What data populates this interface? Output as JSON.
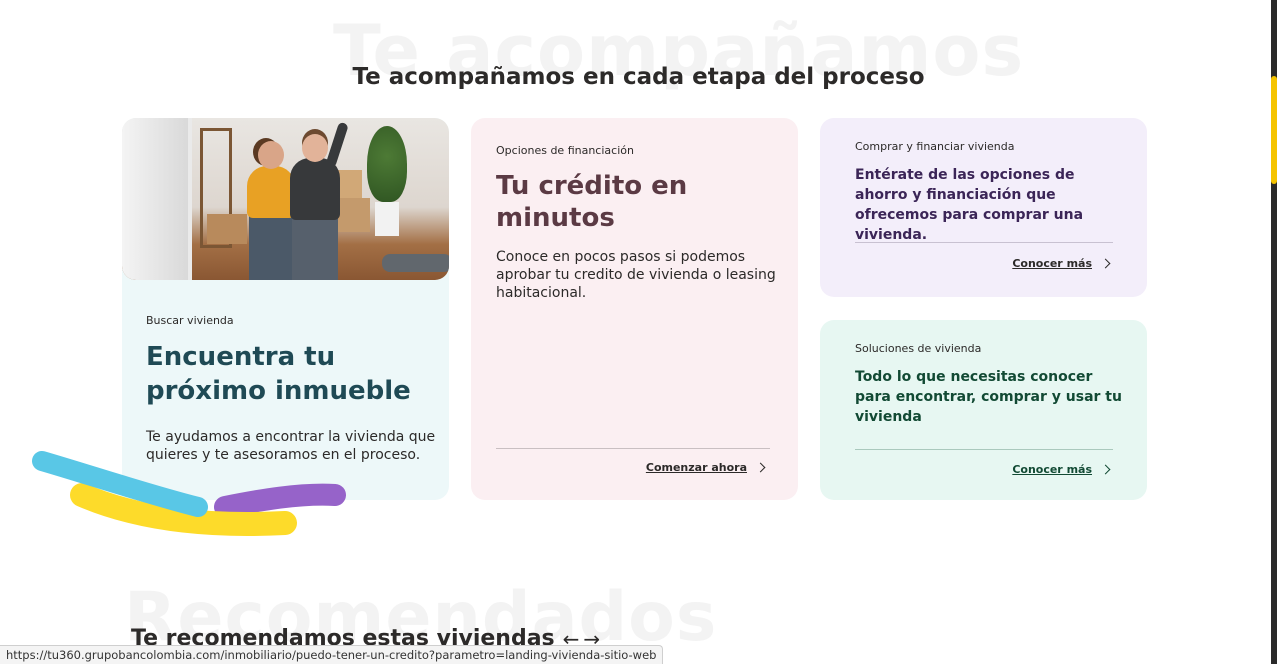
{
  "background_words": {
    "top": "Te acompañamos",
    "bottom": "Recomendados"
  },
  "section_title": "Te acompañamos en cada etapa del proceso",
  "cards": {
    "buscar": {
      "eyebrow": "Buscar vivienda",
      "headline": "Encuentra tu próximo inmueble",
      "body": "Te ayudamos a encontrar la vivienda que quieres y te asesoramos en el proceso."
    },
    "credito": {
      "eyebrow": "Opciones de financiación",
      "headline": "Tu crédito en minutos",
      "body": "Conoce en pocos pasos si podemos aprobar tu credito de vivienda o leasing habitacional.",
      "cta": "Comenzar ahora"
    },
    "comprar": {
      "eyebrow": "Comprar y financiar vivienda",
      "headline": "Entérate de las opciones de ahorro y financiación que ofrecemos para comprar una vivienda.",
      "cta": "Conocer más"
    },
    "soluciones": {
      "eyebrow": "Soluciones de vivienda",
      "headline": "Todo lo que necesitas conocer para encontrar, comprar y usar tu vivienda",
      "cta": "Conocer más"
    }
  },
  "recommended": {
    "title": "Te recomendamos estas viviendas",
    "prev_arrow": "←",
    "next_arrow": "→"
  },
  "status_bar_url": "https://tu360.grupobancolombia.com/inmobiliario/puedo-tener-un-credito?parametro=landing-vivienda-sitio-web",
  "colors": {
    "card_buscar_bg": "#edf8f9",
    "card_credito_bg": "#fbeff2",
    "card_comprar_bg": "#f3eefa",
    "card_soluciones_bg": "#e7f7f2",
    "brush_blue": "#59c7e6",
    "brush_yellow": "#fddb2a",
    "brush_purple": "#9663c9",
    "scroll_thumb": "#f5c400"
  }
}
